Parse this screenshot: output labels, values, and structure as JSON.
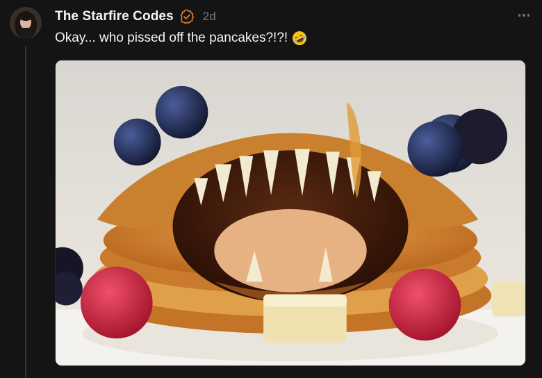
{
  "post": {
    "username": "The Starfire Codes",
    "timestamp": "2d",
    "text": "Okay... who pissed off the pancakes?!?!",
    "emoji": "rolling-on-floor-laughing-emoji",
    "more_icon": "more-horizontal-icon",
    "verified_icon": "verified-badge-icon"
  },
  "colors": {
    "background": "#141414",
    "text": "#f3f5f7",
    "muted": "#777b80",
    "verified": "#f47c20"
  }
}
